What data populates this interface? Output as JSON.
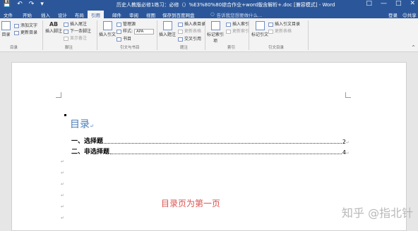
{
  "titlebar": {
    "title": "历史人教版必修1练习：必修（）%E3%80%80综合作业+word版含解析+.doc [兼容模式] - Word",
    "icons": [
      "save-icon",
      "undo-icon",
      "redo-icon",
      "customize-icon"
    ]
  },
  "tabs": [
    "文件",
    "开始",
    "插入",
    "设计",
    "布局",
    "引用",
    "邮件",
    "审阅",
    "视图",
    "保存到百度网盘"
  ],
  "tell_placeholder": "告诉我您想要做什么...",
  "login": "登录",
  "share": "共享",
  "ribbon": {
    "toc": {
      "big": "目录",
      "add_text": "添加文字",
      "update": "更新目录",
      "group": "目录"
    },
    "footnote": {
      "big": "插入脚注",
      "big_label": "AB",
      "insert_endnote": "插入尾注",
      "next_footnote": "下一条脚注",
      "show_notes": "显示备注",
      "group": "脚注"
    },
    "citation": {
      "big": "插入引文",
      "manage": "管理源",
      "style_label": "样式:",
      "style_value": "APA",
      "bibliography": "书目",
      "group": "引文与书目"
    },
    "caption": {
      "big": "插入题注",
      "insert_tof": "插入表目录",
      "update_table": "更新表格",
      "cross_ref": "交叉引用",
      "group": "题注"
    },
    "index": {
      "big": "标记索引项",
      "insert_index": "插入索引",
      "update_index": "更新索引",
      "group": "索引"
    },
    "toa": {
      "big": "标记引文",
      "insert_toa": "插入引文目录",
      "update_table": "更新表格",
      "group": "引文目录"
    }
  },
  "document": {
    "toc_title": "目录",
    "entries": [
      {
        "label": "一、选择题",
        "page": "2"
      },
      {
        "label": "二、非选择题",
        "page": "4"
      }
    ],
    "caption": "目录页为第一页",
    "watermark": "知乎 @指北针"
  }
}
